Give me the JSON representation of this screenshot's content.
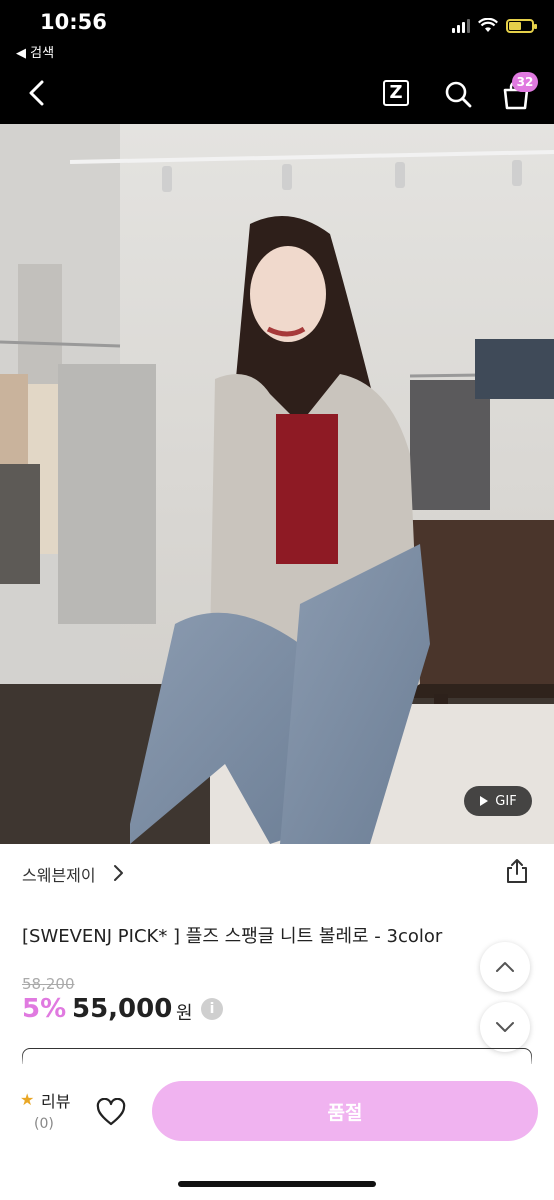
{
  "status_bar": {
    "time": "10:56",
    "back_app": "◀ 검색"
  },
  "header": {
    "z_label": "Z",
    "cart_count": "32"
  },
  "photo": {
    "gif_label": "GIF"
  },
  "product": {
    "brand": "스웨븐제이",
    "title": "[SWEVENJ PICK* ] 플즈 스팽글 니트 볼레로 - 3color",
    "original_price": "58,200",
    "discount": "5%",
    "price": "55,000",
    "currency": "원",
    "info": "i"
  },
  "bottom": {
    "review_label": "리뷰",
    "review_count": "(0)",
    "buy_label": "품절"
  },
  "colors": {
    "accent": "#e07ae0",
    "buy_button": "#f0b3f0"
  },
  "icons": [
    "back-arrow-icon",
    "z-icon",
    "search-icon",
    "bag-icon",
    "share-icon",
    "chevron-right-icon",
    "chevron-up-icon",
    "chevron-down-icon",
    "star-icon",
    "heart-icon",
    "play-icon"
  ]
}
